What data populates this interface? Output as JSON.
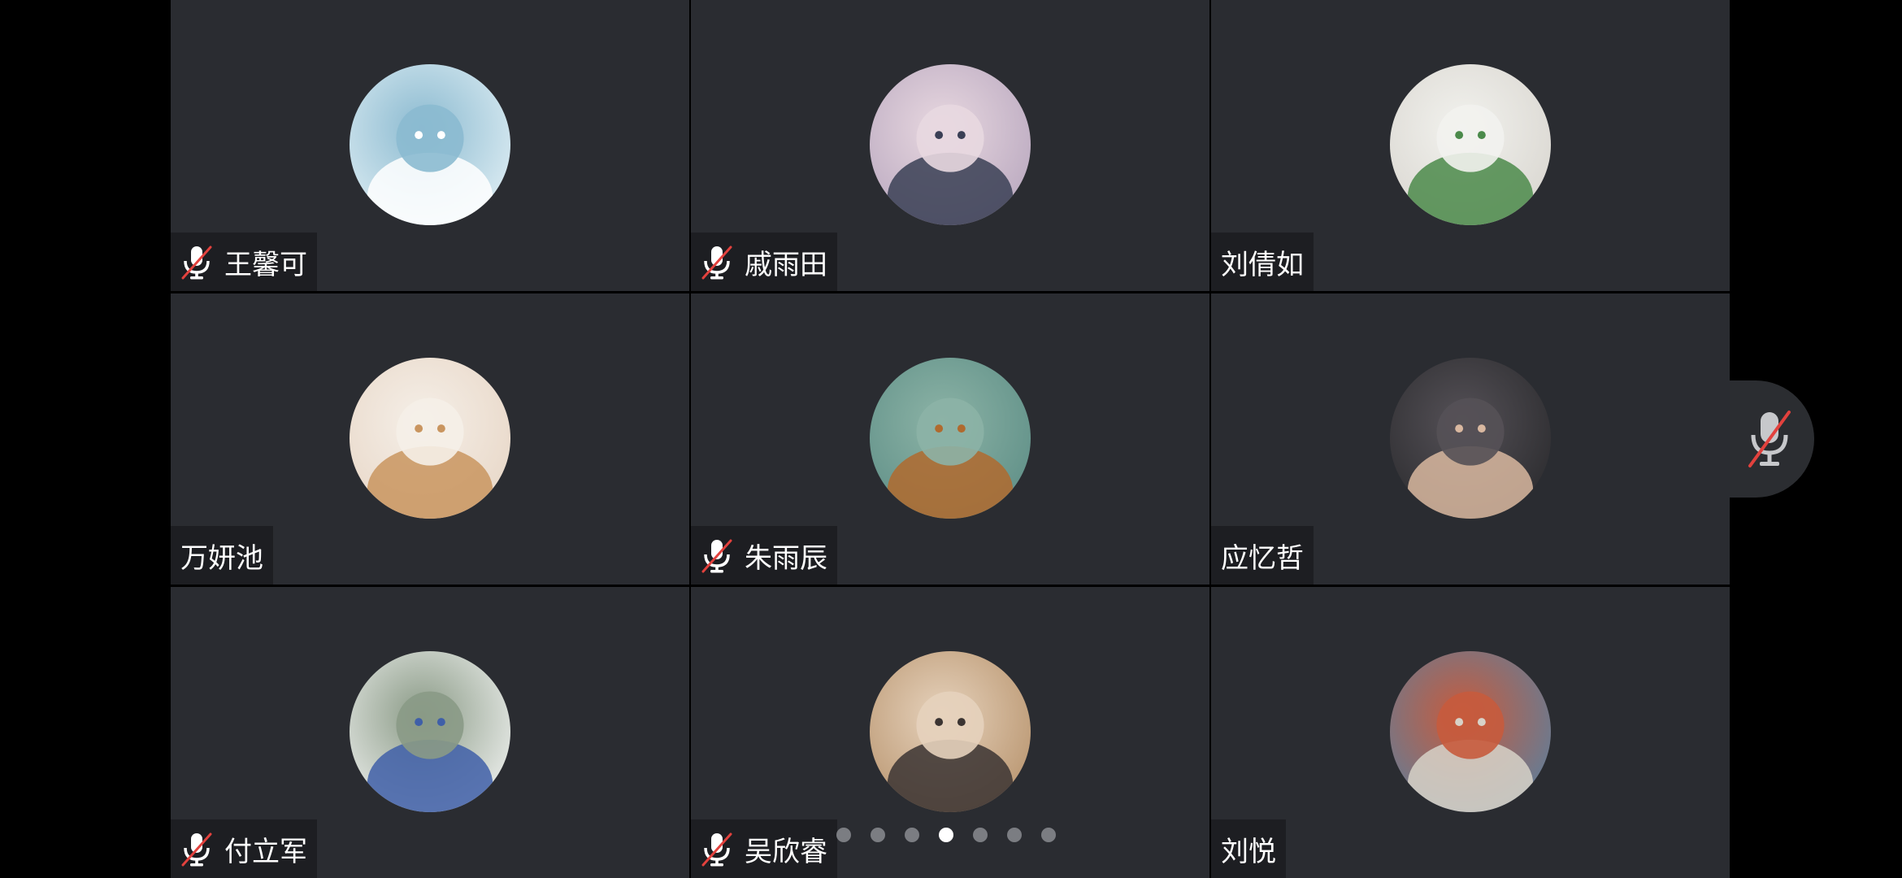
{
  "participants": [
    {
      "name": "王馨可",
      "muted": true,
      "avatar_icon": "white-fox-drawing-avatar",
      "avatar_colors": [
        "#dfeef4",
        "#ffffff",
        "#8bbad0"
      ]
    },
    {
      "name": "戚雨田",
      "muted": true,
      "avatar_icon": "anime-boy-avatar",
      "avatar_colors": [
        "#b9a8bf",
        "#3a3f55",
        "#e8d8e0"
      ]
    },
    {
      "name": "刘倩如",
      "muted": false,
      "avatar_icon": "girl-with-plush-avatar",
      "avatar_colors": [
        "#d9d6d0",
        "#4b8a4a",
        "#f2f2ee"
      ]
    },
    {
      "name": "万妍池",
      "muted": false,
      "avatar_icon": "cat-in-hood-avatar",
      "avatar_colors": [
        "#e8d7c7",
        "#c9955f",
        "#f5efe8"
      ]
    },
    {
      "name": "朱雨辰",
      "muted": true,
      "avatar_icon": "van-gogh-portrait-avatar",
      "avatar_colors": [
        "#5f8f87",
        "#b06a2e",
        "#8cb3a6"
      ]
    },
    {
      "name": "应忆哲",
      "muted": false,
      "avatar_icon": "girl-portrait-avatar",
      "avatar_colors": [
        "#2b2b2e",
        "#d9b8a0",
        "#555157"
      ]
    },
    {
      "name": "付立军",
      "muted": true,
      "avatar_icon": "blue-figure-illustration-avatar",
      "avatar_colors": [
        "#eef0ee",
        "#3f5fa8",
        "#8a9a86"
      ]
    },
    {
      "name": "吴欣睿",
      "muted": true,
      "avatar_icon": "girl-with-puppy-avatar",
      "avatar_colors": [
        "#b8946e",
        "#3b3432",
        "#e6d2bc"
      ]
    },
    {
      "name": "刘悦",
      "muted": false,
      "avatar_icon": "person-with-dog-avatar",
      "avatar_colors": [
        "#5d7f9c",
        "#d7d2c8",
        "#c75b3d"
      ]
    }
  ],
  "side_button": {
    "icon": "mic-muted-icon"
  },
  "pager": {
    "page_count": 7,
    "active_index": 3
  },
  "colors": {
    "tile_bg": "#2a2c31",
    "mute_slash": "#e2413d",
    "dot_inactive": "#7b7d82",
    "dot_active": "#ffffff"
  }
}
